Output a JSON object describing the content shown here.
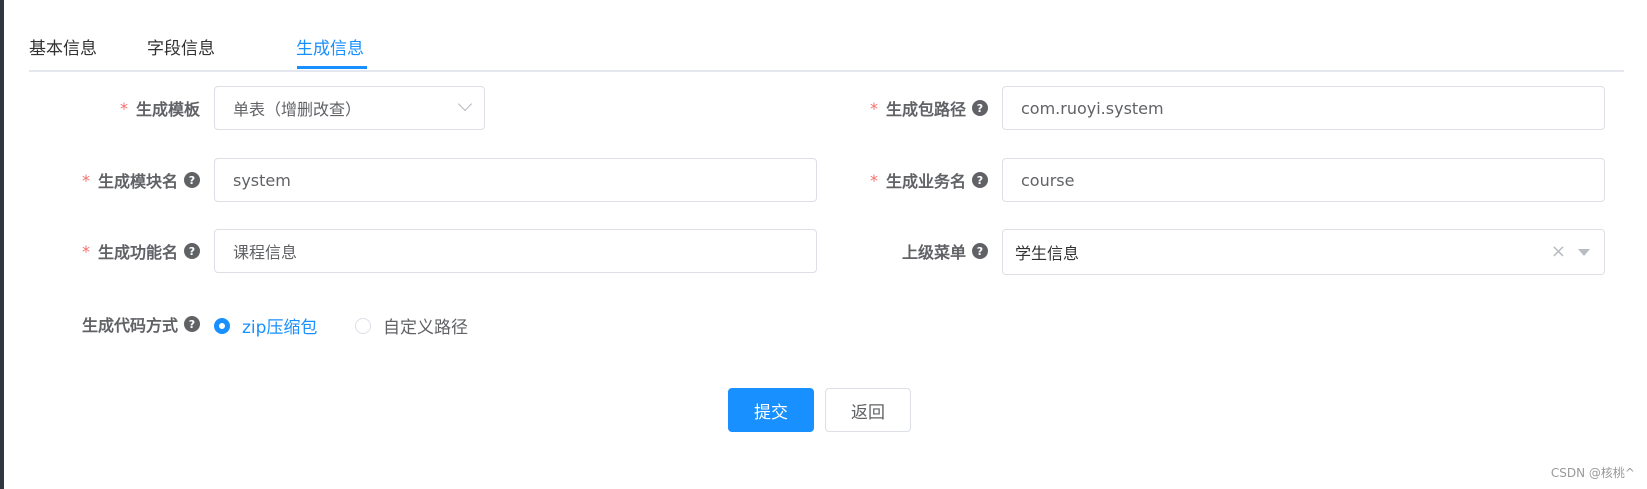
{
  "tabs": [
    "基本信息",
    "字段信息",
    "生成信息"
  ],
  "form": {
    "template": {
      "label": "生成模板",
      "value": "单表（增删改查）"
    },
    "package_path": {
      "label": "生成包路径",
      "value": "com.ruoyi.system"
    },
    "module_name": {
      "label": "生成模块名",
      "value": "system"
    },
    "business_name": {
      "label": "生成业务名",
      "value": "course"
    },
    "function_name": {
      "label": "生成功能名",
      "value": "课程信息"
    },
    "parent_menu": {
      "label": "上级菜单",
      "value": "学生信息"
    },
    "gen_type": {
      "label": "生成代码方式",
      "option_zip": "zip压缩包",
      "option_custom": "自定义路径"
    }
  },
  "buttons": {
    "submit": "提交",
    "back": "返回"
  },
  "watermark": "CSDN @核桃^",
  "colors": {
    "primary": "#1890ff",
    "required": "#f56c6c"
  }
}
